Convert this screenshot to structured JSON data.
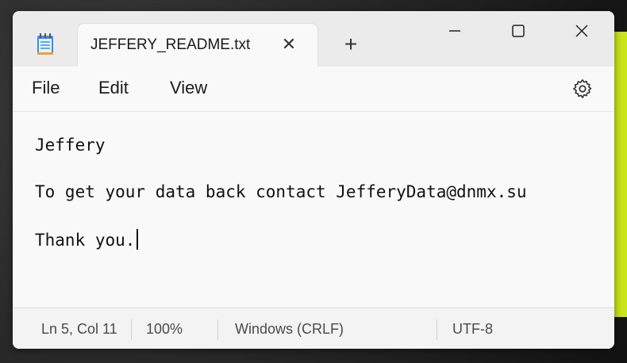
{
  "window": {
    "tab_title": "JEFFERY_README.txt",
    "new_tab_label": "+",
    "close_tab_label": "✕"
  },
  "menu": {
    "file": "File",
    "edit": "Edit",
    "view": "View"
  },
  "icons": {
    "app": "notepad-icon",
    "settings": "gear-icon",
    "minimize": "minimize-icon",
    "maximize": "maximize-icon",
    "close": "close-icon"
  },
  "editor": {
    "lines": [
      "Jeffery",
      "To get your data back contact JefferyData@dnmx.su",
      "Thank you."
    ]
  },
  "status": {
    "position": "Ln 5, Col 11",
    "zoom": "100%",
    "line_endings": "Windows (CRLF)",
    "encoding": "UTF-8"
  },
  "colors": {
    "window_bg": "#f3f3f3",
    "editor_bg": "#f9f9f9",
    "text": "#111111",
    "accent_green": "#c8e619"
  }
}
